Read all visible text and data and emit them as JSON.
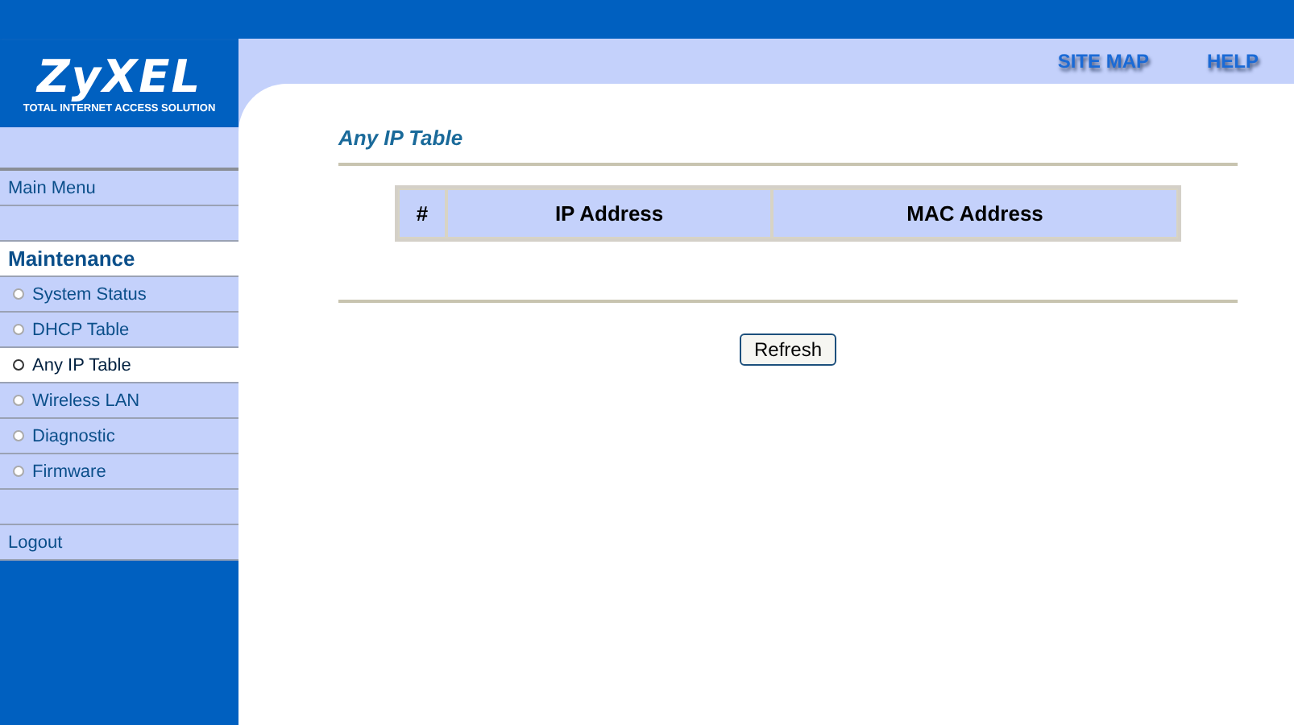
{
  "logo": {
    "brand": "ZyXEL",
    "tagline": "TOTAL INTERNET ACCESS SOLUTION"
  },
  "top_links": [
    "SITE MAP",
    "HELP"
  ],
  "sidebar": {
    "main_menu": "Main Menu",
    "section": "Maintenance",
    "items": [
      {
        "label": "System Status",
        "selected": false
      },
      {
        "label": "DHCP Table",
        "selected": false
      },
      {
        "label": "Any IP Table",
        "selected": true
      },
      {
        "label": "Wireless LAN",
        "selected": false
      },
      {
        "label": "Diagnostic",
        "selected": false
      },
      {
        "label": "Firmware",
        "selected": false
      }
    ],
    "logout": "Logout"
  },
  "page_title": "Any IP Table",
  "table": {
    "columns": [
      "#",
      "IP Address",
      "MAC Address"
    ]
  },
  "buttons": [
    "Refresh"
  ]
}
